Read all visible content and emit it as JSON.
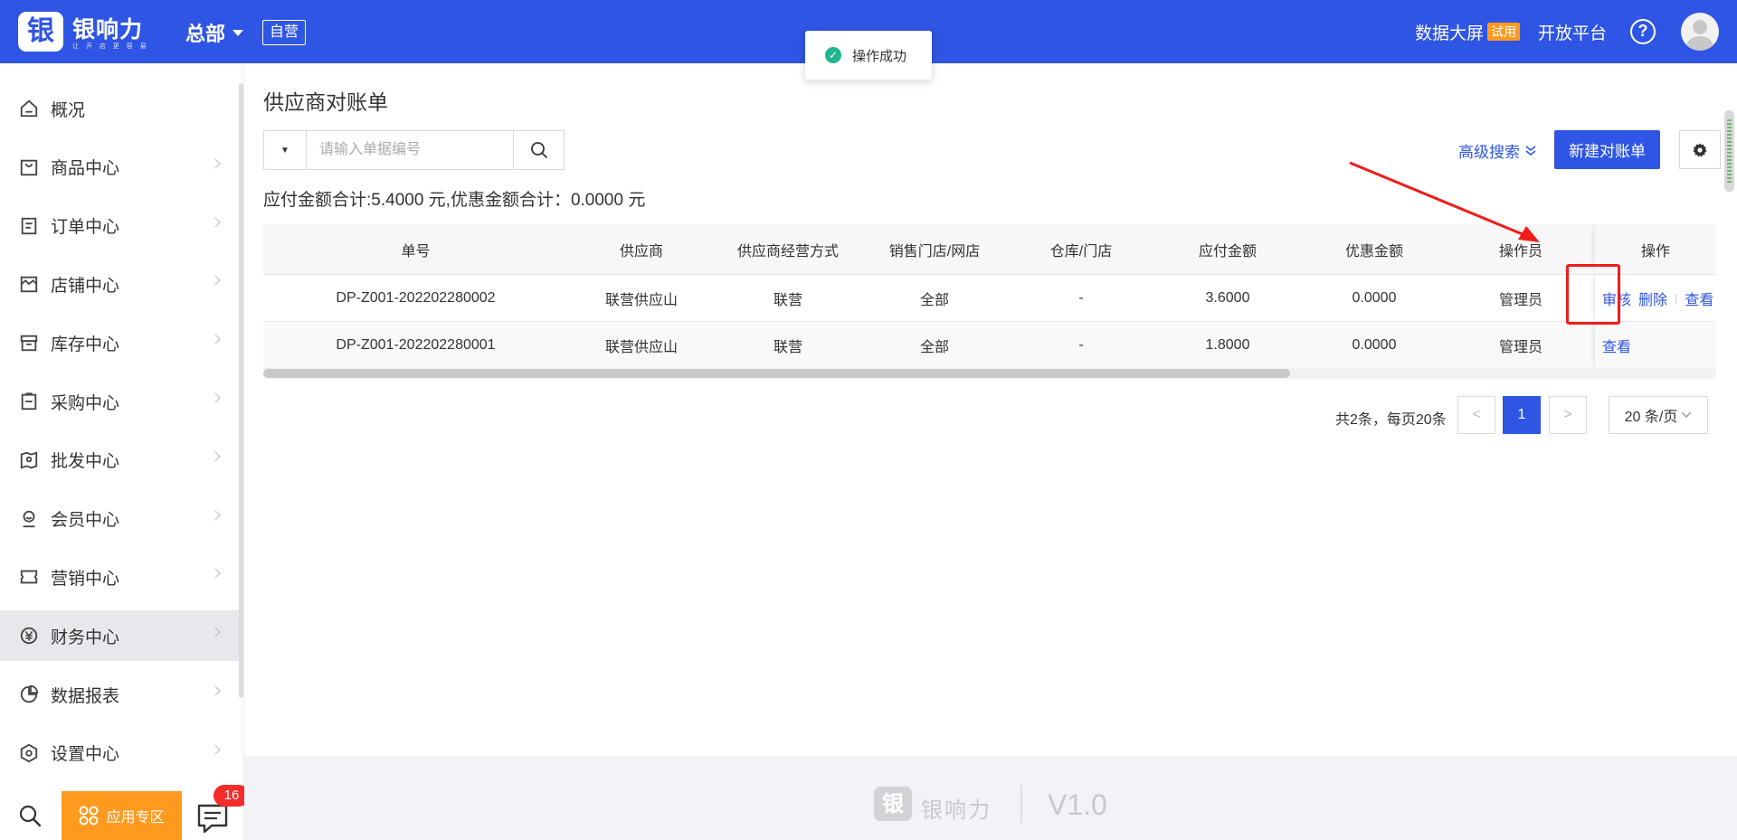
{
  "header": {
    "logo_mark": "银",
    "brand": "银响力",
    "slogan": "让 开 店 更 容 易",
    "org": "总部",
    "org_tag": "自营",
    "data_screen": "数据大屏",
    "trial": "试用",
    "open_platform": "开放平台",
    "help": "?"
  },
  "toast": {
    "text": "操作成功"
  },
  "sidebar": {
    "items": [
      {
        "label": "概况",
        "icon": "home-icon"
      },
      {
        "label": "商品中心",
        "icon": "bag-icon"
      },
      {
        "label": "订单中心",
        "icon": "clipboard-icon"
      },
      {
        "label": "店铺中心",
        "icon": "store-icon"
      },
      {
        "label": "库存中心",
        "icon": "box-icon"
      },
      {
        "label": "采购中心",
        "icon": "purchase-icon"
      },
      {
        "label": "批发中心",
        "icon": "map-icon"
      },
      {
        "label": "会员中心",
        "icon": "member-icon"
      },
      {
        "label": "营销中心",
        "icon": "ticket-icon"
      },
      {
        "label": "财务中心",
        "icon": "finance-icon"
      },
      {
        "label": "数据报表",
        "icon": "pie-chart-icon"
      },
      {
        "label": "设置中心",
        "icon": "settings-hex-icon"
      }
    ],
    "active_index": 9,
    "app_zone": "应用专区",
    "msg_count": "16"
  },
  "main": {
    "title": "供应商对账单",
    "search": {
      "type_caret": "▼",
      "placeholder": "请输入单据编号",
      "value": ""
    },
    "adv_search": "高级搜索",
    "new_button": "新建对账单",
    "summary": "应付金额合计:5.4000 元,优惠金额合计：0.0000 元",
    "table": {
      "columns": [
        "单号",
        "供应商",
        "供应商经营方式",
        "销售门店/网店",
        "仓库/门店",
        "应付金额",
        "优惠金额",
        "操作员",
        "操作"
      ],
      "rows": [
        {
          "no": "DP-Z001-202202280002",
          "supplier": "联营供应山",
          "mode": "联营",
          "store": "全部",
          "warehouse": "-",
          "payable": "3.6000",
          "discount": "0.0000",
          "operator": "管理员",
          "actions": [
            "审核",
            "删除",
            "查看"
          ]
        },
        {
          "no": "DP-Z001-202202280001",
          "supplier": "联营供应山",
          "mode": "联营",
          "store": "全部",
          "warehouse": "-",
          "payable": "1.8000",
          "discount": "0.0000",
          "operator": "管理员",
          "actions": [
            "查看"
          ]
        }
      ]
    },
    "pager": {
      "total": "共2条，每页20条",
      "prev": "<",
      "current": "1",
      "next": ">",
      "size": "20 条/页"
    }
  },
  "footer": {
    "logo_mark": "银",
    "brand": "银响力",
    "version": "V1.0"
  },
  "colors": {
    "primary": "#2f55e4",
    "orange": "#ff9a1e",
    "annotation_red": "#f21b1b",
    "success": "#23b58f"
  }
}
